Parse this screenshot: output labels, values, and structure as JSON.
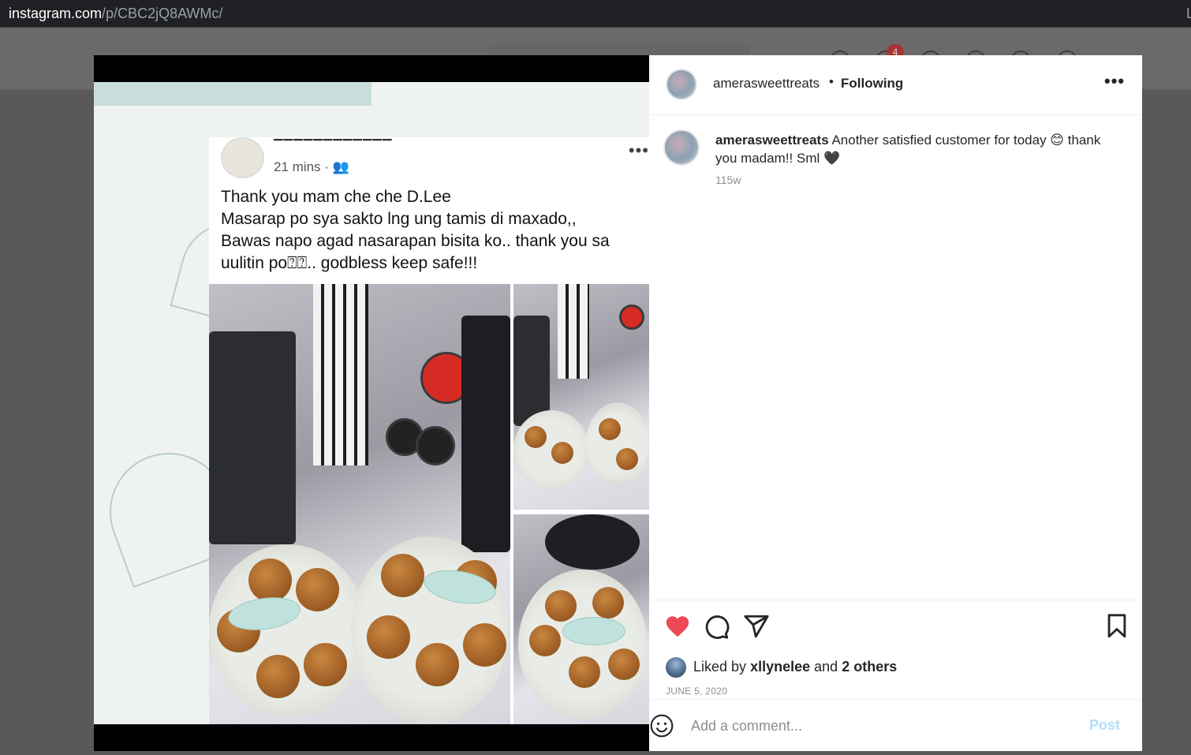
{
  "browser": {
    "url_host": "instagram.com",
    "url_path": "/p/CBC2jQ8AWMc/",
    "edge_glyph": "L"
  },
  "background_nav": {
    "notification_count": "4"
  },
  "post_image": {
    "fb_post": {
      "time": "21 mins",
      "text_lines": [
        "Thank you mam che che D.Lee",
        "Masarap po sya sakto lng ung tamis di maxado,,",
        "Bawas napo agad nasarapan bisita ko.. thank you sa",
        "uulitin po⍰⍰.. godbless keep safe!!!"
      ]
    }
  },
  "header": {
    "username": "amerasweettreats",
    "separator": "•",
    "follow_status": "Following",
    "more_label": "•••"
  },
  "caption": {
    "username": "amerasweettreats",
    "text": "Another satisfied customer for today 😊 thank you madam!! Sml 🖤",
    "age": "115w"
  },
  "likes": {
    "prefix": "Liked by",
    "user": "xllynelee",
    "middle": "and",
    "others": "2 others"
  },
  "date": "JUNE 5, 2020",
  "comment_box": {
    "placeholder": "Add a comment...",
    "post_label": "Post"
  },
  "colors": {
    "like_red": "#ed4956",
    "post_disabled_blue": "#b2dffc"
  },
  "icons": [
    "heart-icon",
    "comment-icon",
    "share-icon",
    "bookmark-icon",
    "emoji-icon",
    "more-icon"
  ]
}
